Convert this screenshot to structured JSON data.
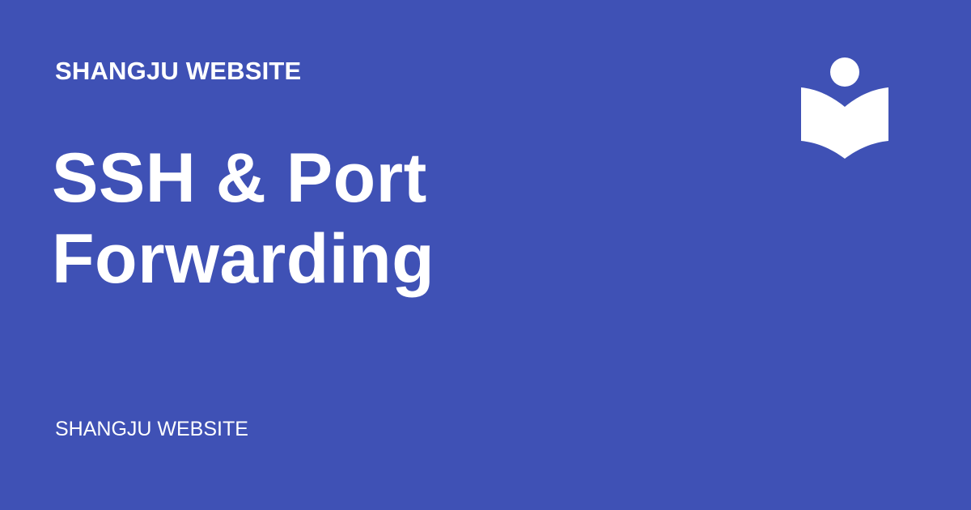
{
  "card": {
    "site_name_top": "SHANGJU WEBSITE",
    "title": "SSH & Port Forwarding",
    "site_name_bottom": "SHANGJU WEBSITE",
    "logo_icon": "reader-book-icon",
    "colors": {
      "background": "#3f51b5",
      "text": "#ffffff"
    }
  }
}
